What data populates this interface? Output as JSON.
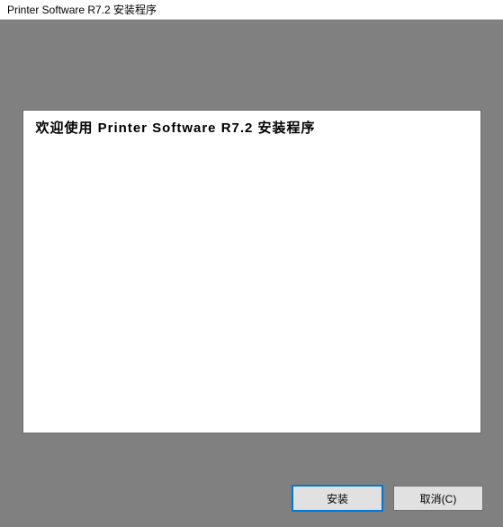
{
  "window": {
    "title": "Printer Software R7.2 安装程序"
  },
  "content": {
    "welcome_heading": "欢迎使用 Printer Software R7.2 安装程序"
  },
  "buttons": {
    "install": "安装",
    "cancel": "取消(C)"
  }
}
